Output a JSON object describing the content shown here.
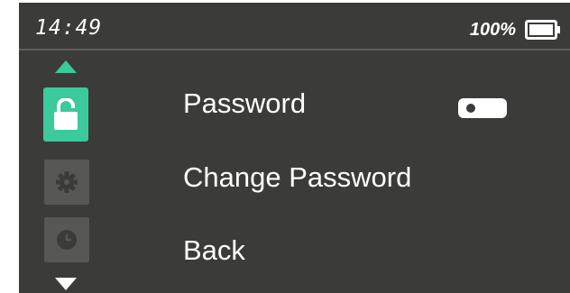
{
  "status_bar": {
    "time": "14:49",
    "battery_level": "100%",
    "battery_fill_fraction": 1.0,
    "battery_icon": "battery-full-icon"
  },
  "sidebar": {
    "scroll_up_icon": "triangle-up-icon",
    "scroll_down_icon": "triangle-down-icon",
    "tabs": [
      {
        "icon": "unlock-icon",
        "active": true
      },
      {
        "icon": "gear-icon",
        "active": false
      },
      {
        "icon": "clock-icon",
        "active": false
      }
    ]
  },
  "menu": {
    "items": [
      {
        "label": "Password",
        "has_toggle": true,
        "toggle_on": false
      },
      {
        "label": "Change Password"
      },
      {
        "label": "Back"
      }
    ]
  },
  "colors": {
    "background": "#3b3b39",
    "accent": "#3cc99b",
    "inactive_tab": "#575755",
    "divider": "#5e5e5a",
    "toggle_track": "#ffffff",
    "text": "#ffffff"
  }
}
